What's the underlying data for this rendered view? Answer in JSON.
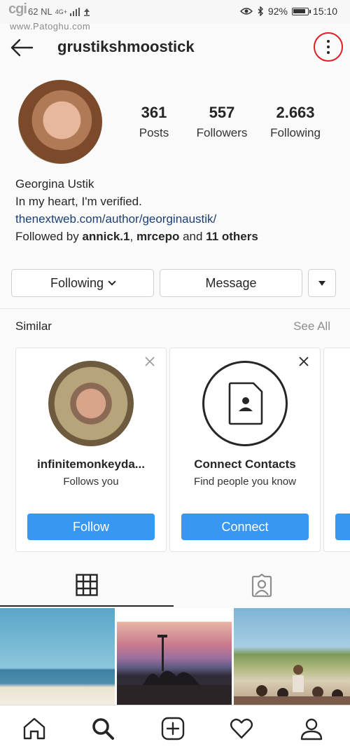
{
  "status_bar": {
    "carrier": "62 NL",
    "network": "4G+",
    "battery": "92%",
    "time": "15:10"
  },
  "watermark": {
    "logo": "cgi",
    "site": "www.Patoghu.com"
  },
  "header": {
    "username": "grustikshmoostick"
  },
  "profile": {
    "stats": [
      {
        "value": "361",
        "label": "Posts"
      },
      {
        "value": "557",
        "label": "Followers"
      },
      {
        "value": "2.663",
        "label": "Following"
      }
    ],
    "name": "Georgina Ustik",
    "bio": "In my heart, I'm verified.",
    "link": "thenextweb.com/author/georginaustik/",
    "followed_by_prefix": "Followed by ",
    "followed_by_user1": "annick.1",
    "followed_by_sep": ", ",
    "followed_by_user2": "mrcepo",
    "followed_by_and": " and ",
    "followed_by_others": "11 others"
  },
  "actions": {
    "following_label": "Following",
    "message_label": "Message"
  },
  "similar": {
    "title": "Similar",
    "see_all": "See All",
    "cards": [
      {
        "title": "infinitemonkeyda...",
        "subtitle": "Follows you",
        "button": "Follow"
      },
      {
        "title": "Connect Contacts",
        "subtitle": "Find people you know",
        "button": "Connect"
      }
    ]
  },
  "colors": {
    "accent": "#3897f0",
    "highlight_ring": "#e31b23",
    "link": "#1c3f73"
  },
  "icons": [
    "back-arrow-icon",
    "more-vertical-icon",
    "close-icon",
    "contact-card-icon",
    "grid-icon",
    "tagged-icon",
    "home-icon",
    "search-icon",
    "add-icon",
    "heart-icon",
    "profile-icon"
  ]
}
